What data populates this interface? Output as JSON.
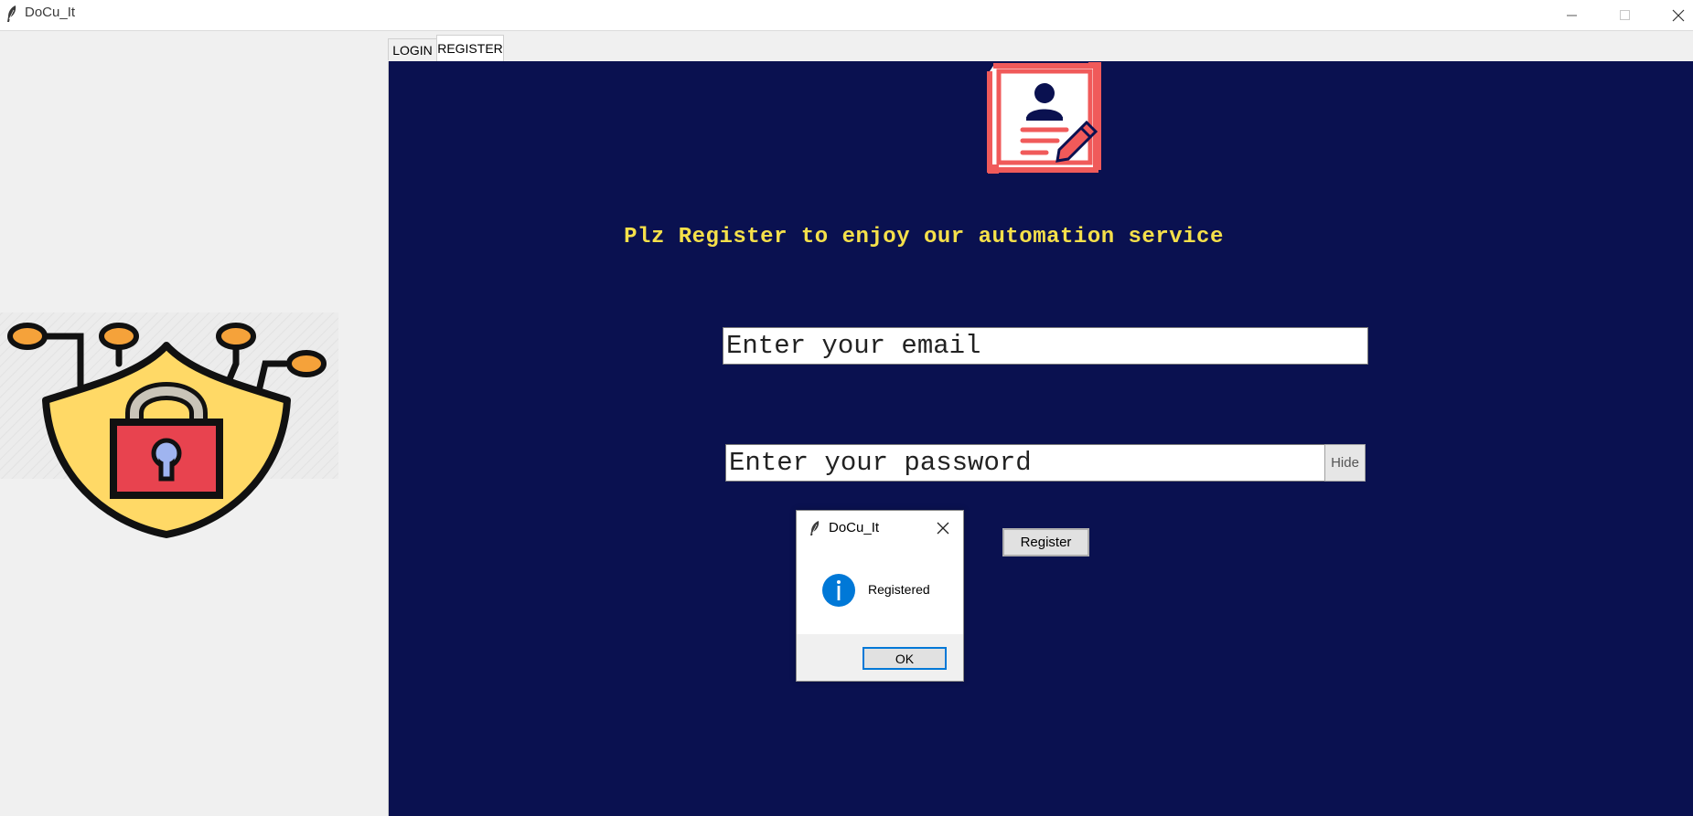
{
  "window": {
    "title": "DoCu_It",
    "controls": [
      "minimize",
      "maximize",
      "close"
    ]
  },
  "tabs": [
    {
      "label": "LOGIN",
      "active": false
    },
    {
      "label": "REGISTER",
      "active": true
    }
  ],
  "register": {
    "headline": "Plz Register to enjoy our automation service",
    "email_value": "Enter your email",
    "password_value": "Enter your password",
    "hide_label": "Hide",
    "register_label": "Register"
  },
  "dialog": {
    "title": "DoCu_It",
    "message": "Registered",
    "ok_label": "OK"
  },
  "icons": {
    "app": "feather-icon",
    "left_illustration": "security-shield-lock-icon",
    "header_illustration": "register-document-icon",
    "dialog_info": "info-icon"
  },
  "colors": {
    "panel_bg": "#0a1150",
    "headline": "#f5e04a",
    "accent_red": "#f05a5a",
    "shield_yellow": "#ffd966",
    "lock_red": "#e8434f",
    "info_blue": "#0078d7"
  }
}
